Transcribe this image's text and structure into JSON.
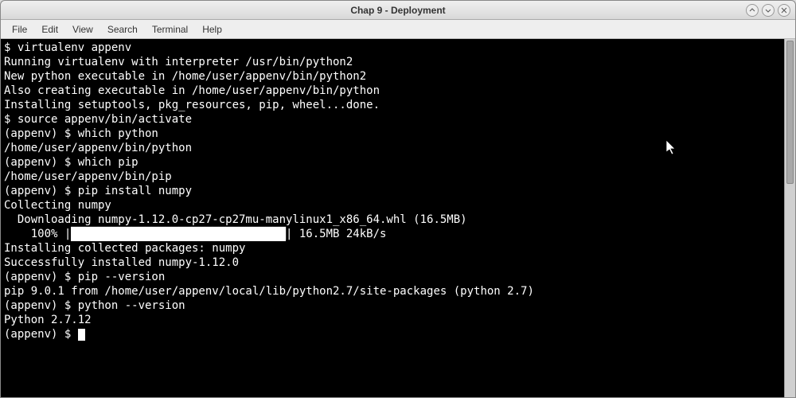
{
  "window": {
    "title": "Chap 9  - Deployment"
  },
  "menu": {
    "file": "File",
    "edit": "Edit",
    "view": "View",
    "search": "Search",
    "terminal": "Terminal",
    "help": "Help"
  },
  "terminal": {
    "lines": [
      "$ virtualenv appenv",
      "Running virtualenv with interpreter /usr/bin/python2",
      "New python executable in /home/user/appenv/bin/python2",
      "Also creating executable in /home/user/appenv/bin/python",
      "Installing setuptools, pkg_resources, pip, wheel...done.",
      "$ source appenv/bin/activate",
      "(appenv) $ which python",
      "/home/user/appenv/bin/python",
      "(appenv) $ which pip",
      "/home/user/appenv/bin/pip",
      "(appenv) $ pip install numpy",
      "Collecting numpy",
      "  Downloading numpy-1.12.0-cp27-cp27mu-manylinux1_x86_64.whl (16.5MB)"
    ],
    "progress_prefix": "    100% |",
    "progress_fill": "████████████████████████████████",
    "progress_suffix": "| 16.5MB 24kB/s",
    "lines_after": [
      "Installing collected packages: numpy",
      "Successfully installed numpy-1.12.0",
      "(appenv) $ pip --version",
      "pip 9.0.1 from /home/user/appenv/local/lib/python2.7/site-packages (python 2.7)",
      "(appenv) $ python --version",
      "Python 2.7.12"
    ],
    "prompt_final": "(appenv) $ "
  }
}
